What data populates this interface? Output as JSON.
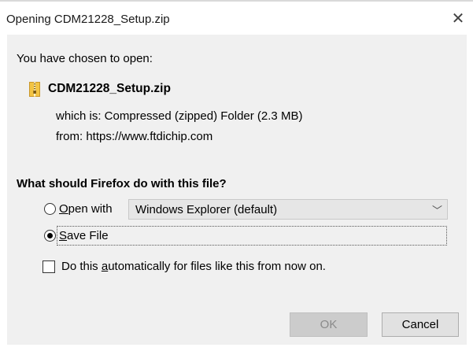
{
  "dialog": {
    "title": "Opening CDM21228_Setup.zip",
    "close_glyph": "✕"
  },
  "content": {
    "intro": "You have chosen to open:",
    "file_icon": "zip-folder-icon",
    "filename": "CDM21228_Setup.zip",
    "which_is": "which is: Compressed (zipped) Folder (2.3 MB)",
    "from": "from: https://www.ftdichip.com",
    "question": "What should Firefox do with this file?"
  },
  "options": {
    "open_with": {
      "mnemonic": "O",
      "rest": "pen with",
      "selected": false
    },
    "application": {
      "value": "Windows Explorer (default)",
      "chevron": "﹀"
    },
    "save_file": {
      "mnemonic": "S",
      "rest": "ave File",
      "selected": true
    }
  },
  "auto": {
    "pre": "Do this ",
    "mnemonic": "a",
    "post": "utomatically for files like this from now on.",
    "checked": false
  },
  "buttons": {
    "ok": "OK",
    "ok_enabled": false,
    "cancel": "Cancel"
  }
}
